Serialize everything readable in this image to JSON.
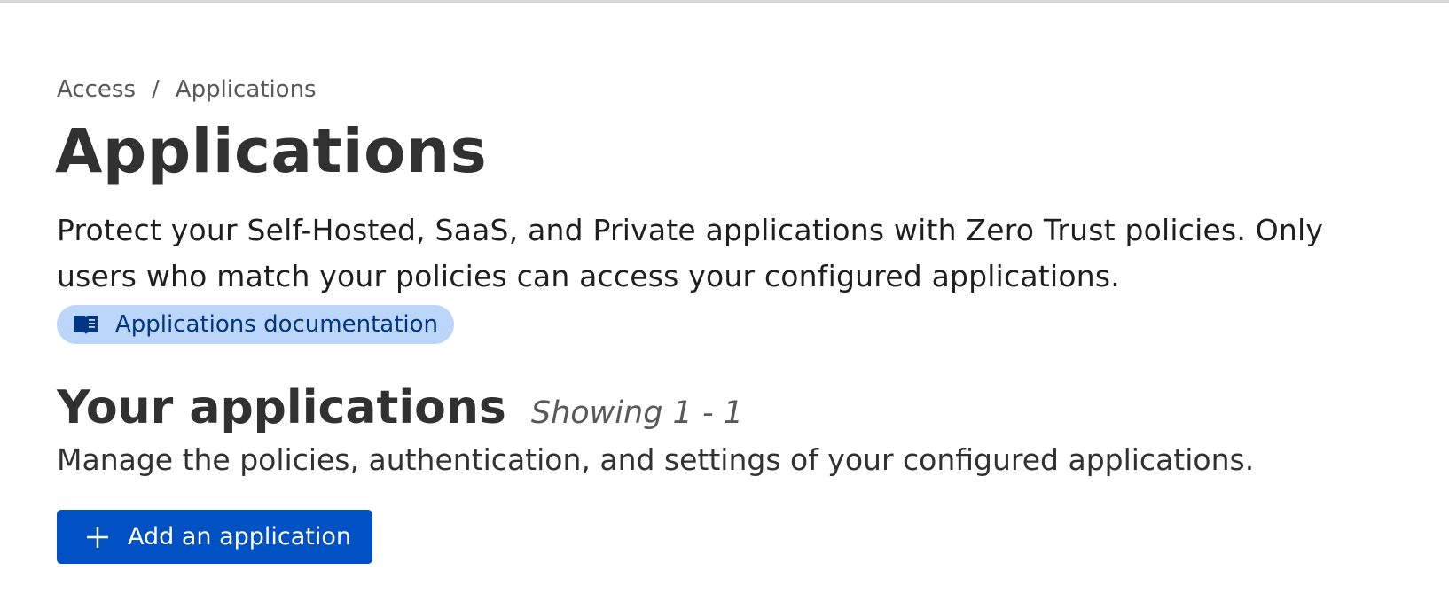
{
  "breadcrumb": {
    "items": [
      "Access",
      "Applications"
    ],
    "separator": "/"
  },
  "header": {
    "title": "Applications",
    "description": "Protect your Self-Hosted, SaaS, and Private applications with Zero Trust policies. Only users who match your policies can access your configured applications."
  },
  "docs_link": {
    "label": "Applications documentation",
    "icon": "book-icon",
    "background": "#bcd6fb",
    "text_color": "#003682"
  },
  "applications_section": {
    "title": "Your applications",
    "count_text": "Showing 1 - 1",
    "description": "Manage the policies, authentication, and settings of your configured applications.",
    "add_button_label": "Add an application",
    "add_button_icon": "plus-icon",
    "accent": "#0051c3"
  }
}
